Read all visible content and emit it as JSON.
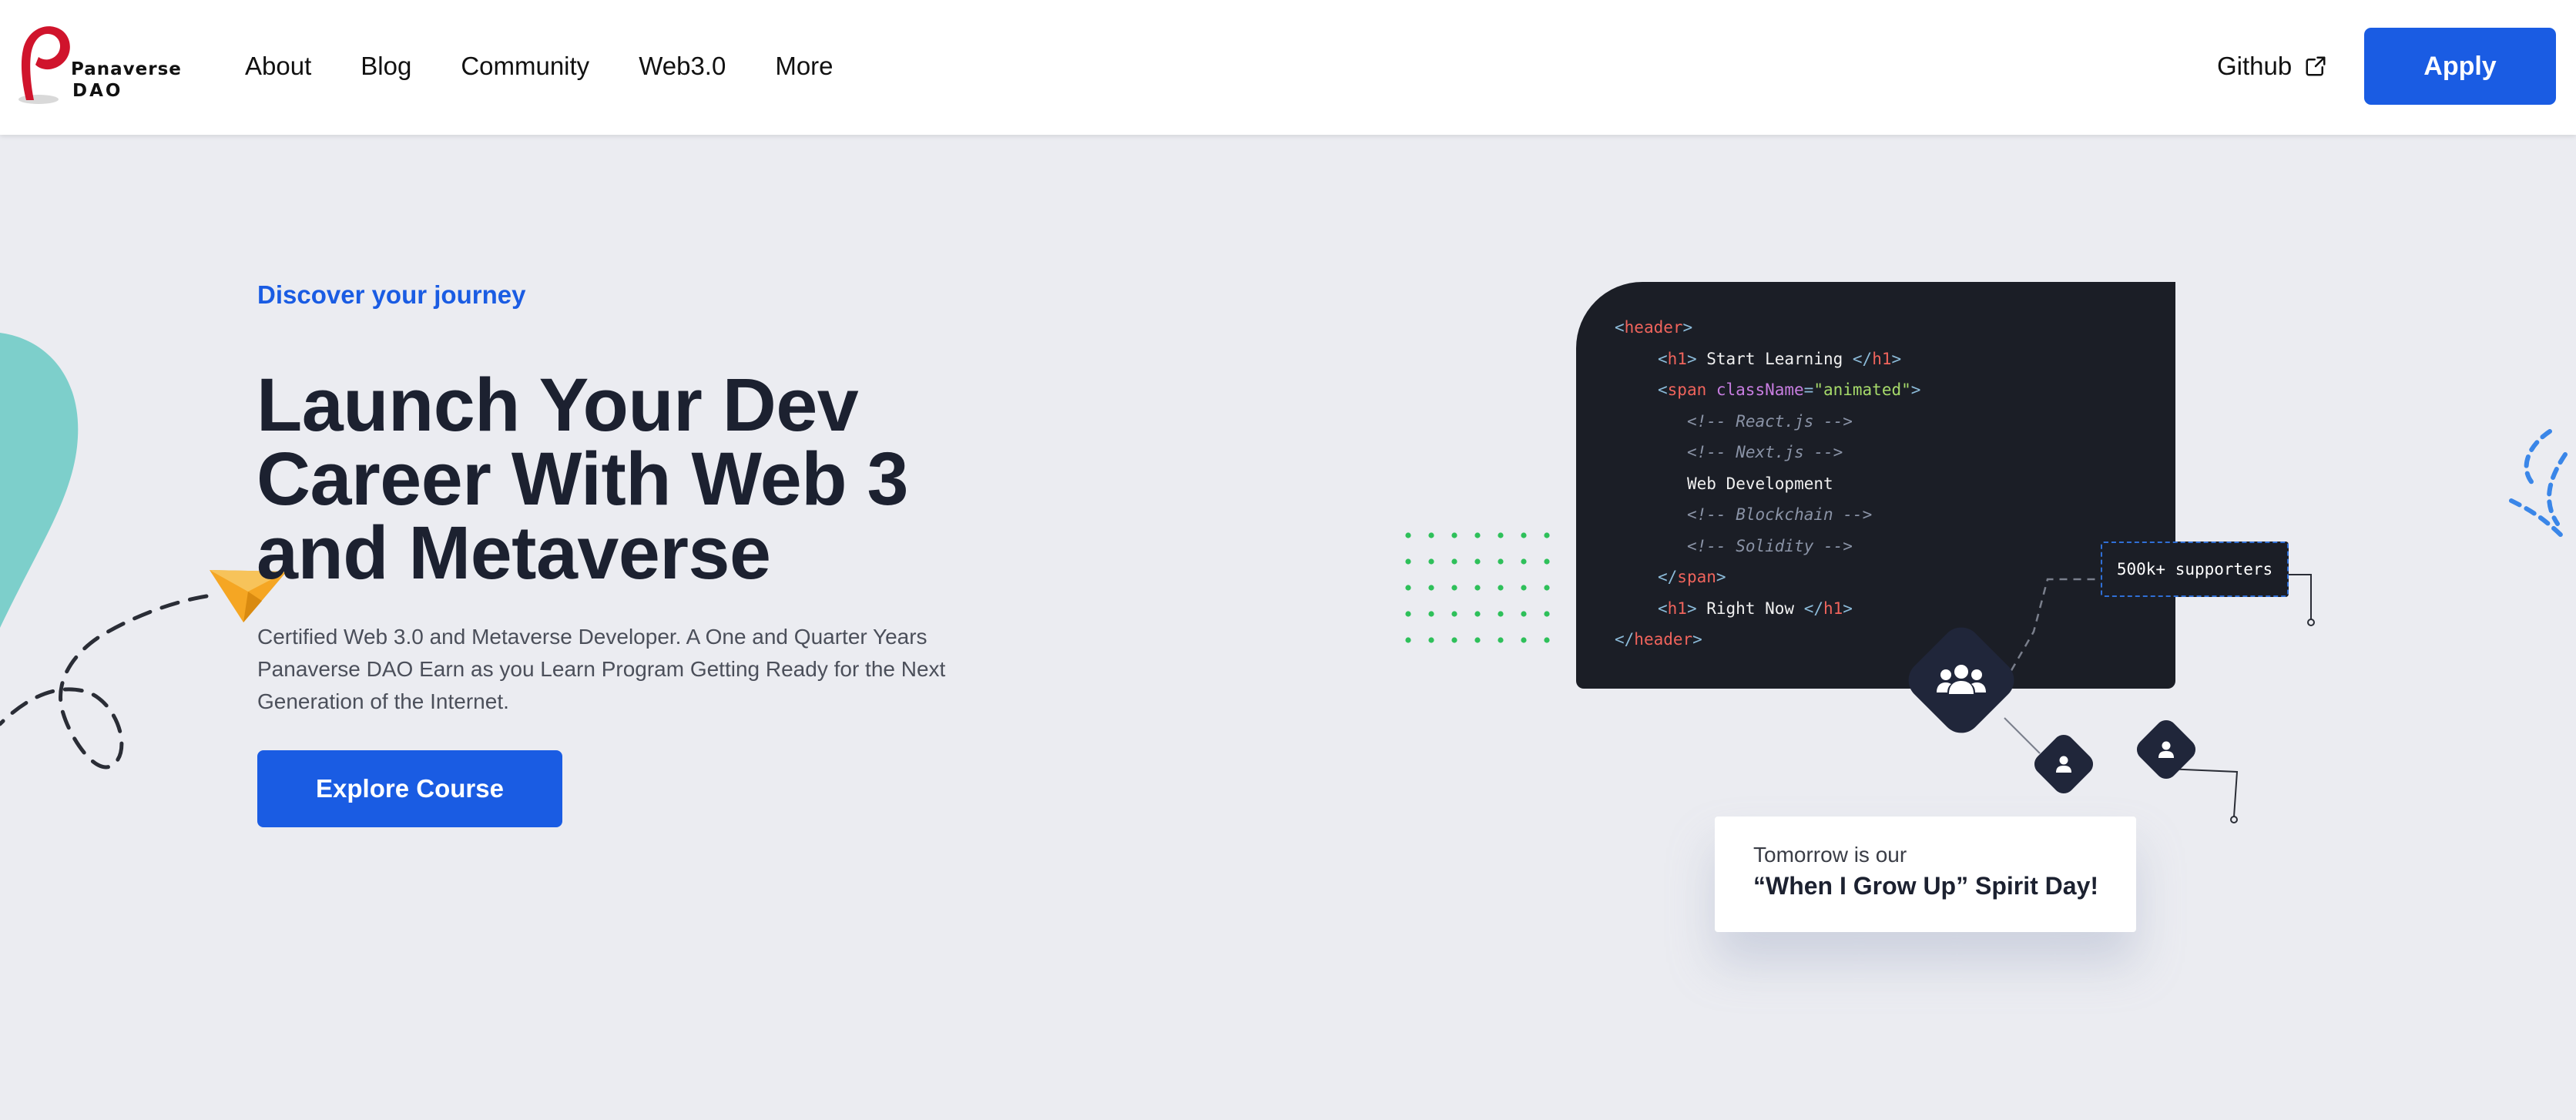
{
  "brand": {
    "name_line1": "Panaverse",
    "name_line2": "DAO",
    "primary_color": "#1a5ce3",
    "logo_color": "#d0142c"
  },
  "nav": {
    "items": [
      {
        "label": "About"
      },
      {
        "label": "Blog"
      },
      {
        "label": "Community"
      },
      {
        "label": "Web3.0"
      },
      {
        "label": "More"
      }
    ],
    "github_label": "Github",
    "apply_label": "Apply"
  },
  "hero": {
    "eyebrow": "Discover your journey",
    "title_lines": [
      "Launch Your Dev",
      "Career With Web 3",
      "and Metaverse"
    ],
    "description": "Certified Web 3.0 and Metaverse Developer. A One and Quarter Years Panaverse DAO Earn as you Learn Program Getting Ready for the Next Generation of the Internet.",
    "cta_label": "Explore Course"
  },
  "code_card": {
    "lines": [
      {
        "indent": 0,
        "tokens": [
          {
            "t": "<",
            "c": "br"
          },
          {
            "t": "header",
            "c": "tag"
          },
          {
            "t": ">",
            "c": "br"
          }
        ]
      },
      {
        "indent": 1,
        "tokens": [
          {
            "t": "<",
            "c": "br"
          },
          {
            "t": "h1",
            "c": "tag"
          },
          {
            "t": "> ",
            "c": "br"
          },
          {
            "t": "Start Learning ",
            "c": "txt"
          },
          {
            "t": "</",
            "c": "br"
          },
          {
            "t": "h1",
            "c": "tag"
          },
          {
            "t": ">",
            "c": "br"
          }
        ]
      },
      {
        "indent": 1,
        "tokens": [
          {
            "t": "<",
            "c": "br"
          },
          {
            "t": "span",
            "c": "tag"
          },
          {
            "t": " className",
            "c": "attr"
          },
          {
            "t": "=",
            "c": "br"
          },
          {
            "t": "\"animated\"",
            "c": "str"
          },
          {
            "t": ">",
            "c": "br"
          }
        ]
      },
      {
        "indent": 2,
        "tokens": [
          {
            "t": "<!-- React.js -->",
            "c": "cm"
          }
        ]
      },
      {
        "indent": 2,
        "tokens": [
          {
            "t": "<!-- Next.js -->",
            "c": "cm"
          }
        ]
      },
      {
        "indent": 2,
        "tokens": [
          {
            "t": "Web Development",
            "c": "txt"
          }
        ]
      },
      {
        "indent": 2,
        "tokens": [
          {
            "t": "<!-- Blockchain -->",
            "c": "cm"
          }
        ]
      },
      {
        "indent": 2,
        "tokens": [
          {
            "t": "<!-- Solidity -->",
            "c": "cm"
          }
        ]
      },
      {
        "indent": 1,
        "tokens": [
          {
            "t": "</",
            "c": "br"
          },
          {
            "t": "span",
            "c": "tag"
          },
          {
            "t": ">",
            "c": "br"
          }
        ]
      },
      {
        "indent": 1,
        "tokens": [
          {
            "t": "<",
            "c": "br"
          },
          {
            "t": "h1",
            "c": "tag"
          },
          {
            "t": "> ",
            "c": "br"
          },
          {
            "t": "Right Now ",
            "c": "txt"
          },
          {
            "t": "</",
            "c": "br"
          },
          {
            "t": "h1",
            "c": "tag"
          },
          {
            "t": ">",
            "c": "br"
          }
        ]
      },
      {
        "indent": 0,
        "tokens": [
          {
            "t": "</",
            "c": "br"
          },
          {
            "t": "header",
            "c": "tag"
          },
          {
            "t": ">",
            "c": "br"
          }
        ]
      }
    ]
  },
  "supporters_badge": "500k+ supporters",
  "spirit_card": {
    "line1": "Tomorrow is our",
    "line2": "“When I Grow Up” Spirit Day!"
  },
  "icons": [
    "external-link-icon",
    "group-icon",
    "user-icon",
    "paper-plane-icon"
  ]
}
